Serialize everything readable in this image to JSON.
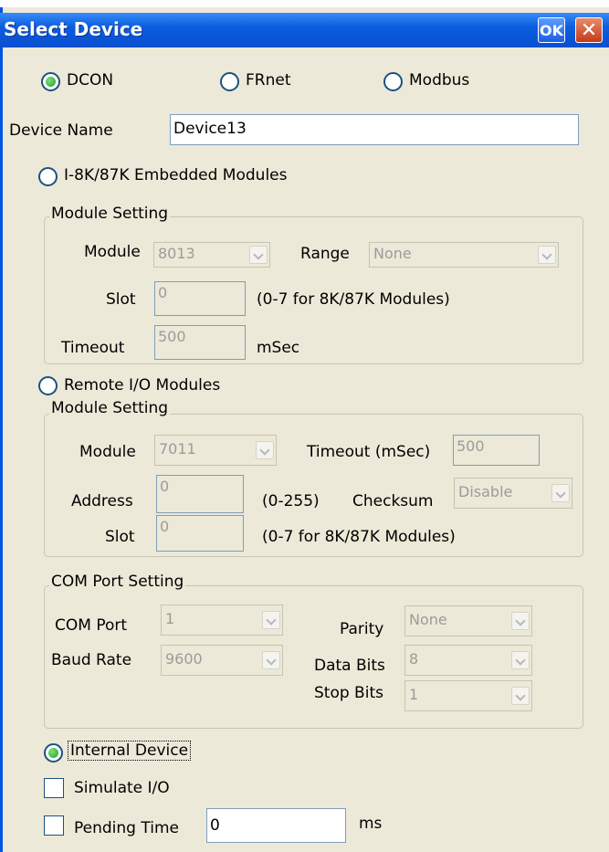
{
  "title": "Select Device",
  "titlebar": {
    "ok": "OK",
    "close": "✕"
  },
  "protocol": {
    "dcon": "DCON",
    "frnet": "FRnet",
    "modbus": "Modbus",
    "selected": "DCON"
  },
  "device_name": {
    "label": "Device Name",
    "value": "Device13"
  },
  "embedded": {
    "radio_label": "I-8K/87K Embedded Modules",
    "group": "Module Setting",
    "module_label": "Module",
    "module_value": "8013",
    "range_label": "Range",
    "range_value": "None",
    "slot_label": "Slot",
    "slot_value": "0",
    "slot_hint": "(0-7 for 8K/87K Modules)",
    "timeout_label": "Timeout",
    "timeout_value": "500",
    "timeout_unit": "mSec"
  },
  "remote": {
    "radio_label": "Remote I/O Modules",
    "group": "Module Setting",
    "module_label": "Module",
    "module_value": "7011",
    "timeout_label": "Timeout (mSec)",
    "timeout_value": "500",
    "address_label": "Address",
    "address_value": "0",
    "address_hint": "(0-255)",
    "checksum_label": "Checksum",
    "checksum_value": "Disable",
    "slot_label": "Slot",
    "slot_value": "0",
    "slot_hint": "(0-7 for 8K/87K Modules)"
  },
  "com": {
    "group": "COM Port Setting",
    "port_label": "COM Port",
    "port_value": "1",
    "baud_label": "Baud Rate",
    "baud_value": "9600",
    "parity_label": "Parity",
    "parity_value": "None",
    "databits_label": "Data Bits",
    "databits_value": "8",
    "stopbits_label": "Stop Bits",
    "stopbits_value": "1"
  },
  "internal": {
    "label": "Internal Device"
  },
  "simulate": {
    "label": "Simulate I/O"
  },
  "pending": {
    "label": "Pending Time",
    "value": "0",
    "unit": "ms"
  }
}
